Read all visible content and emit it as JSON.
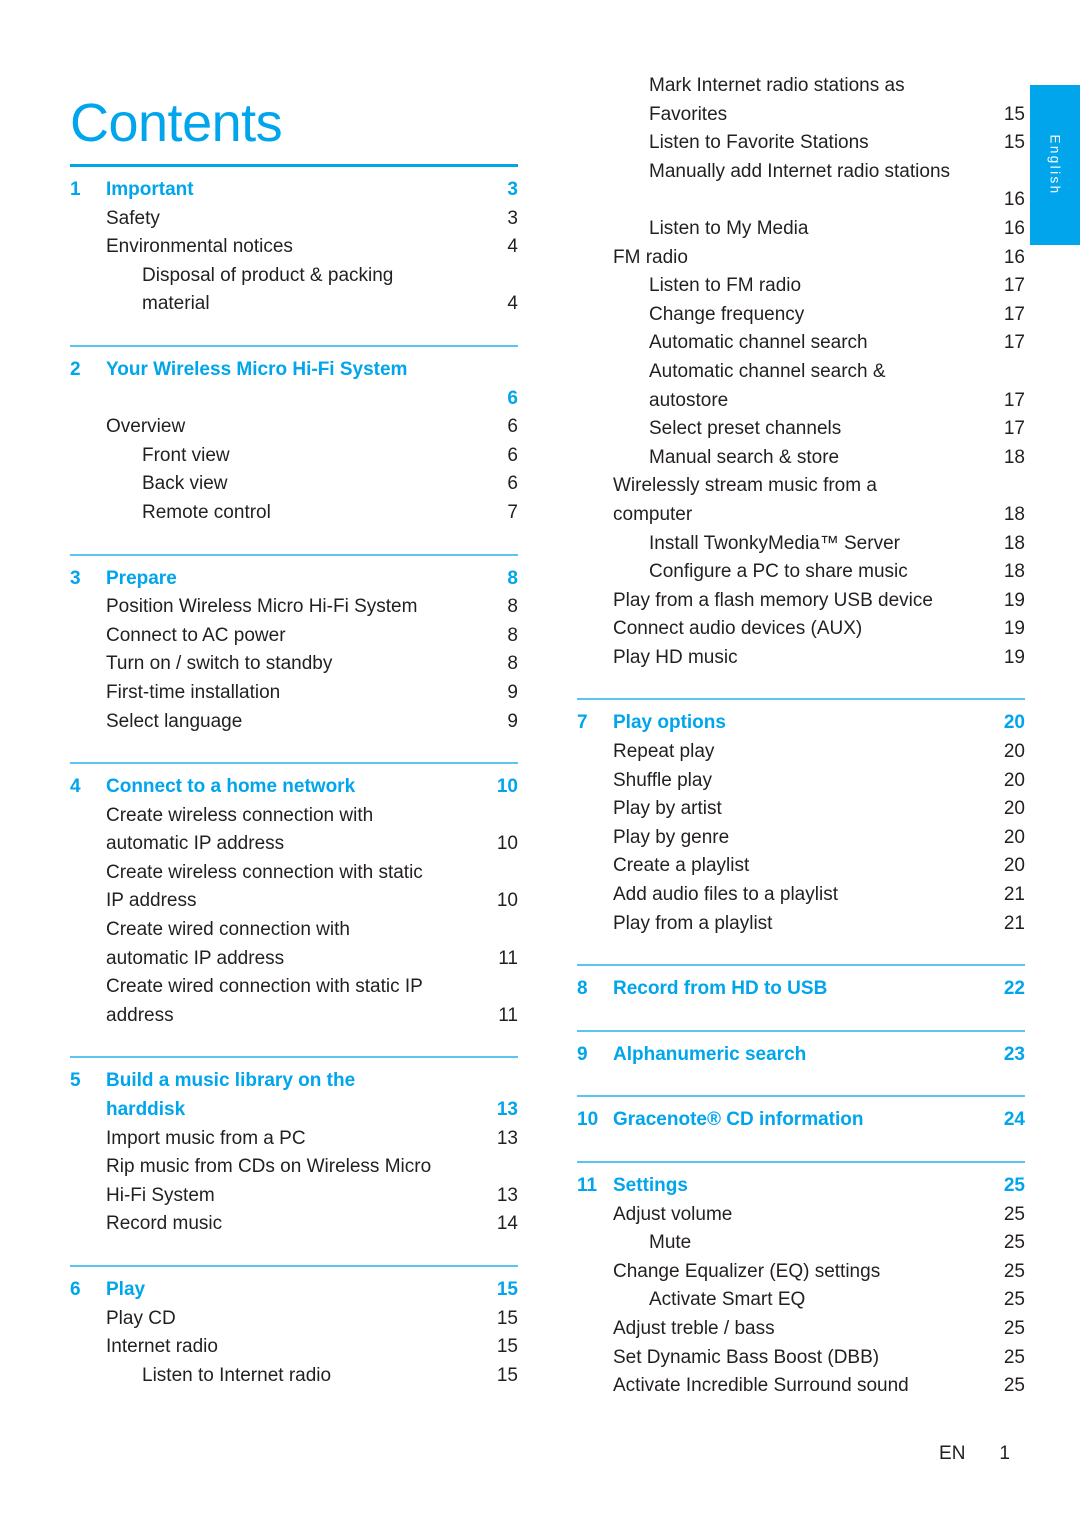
{
  "page_title": "Contents",
  "language_tab": "English",
  "colors": {
    "accent": "#00a5ec",
    "rule_light": "#5bc5f2",
    "text": "#231f20"
  },
  "footer": {
    "language_code": "EN",
    "page_number": "1"
  },
  "left_column": [
    {
      "type": "chapter",
      "number": "1",
      "title": "Important",
      "page": "3",
      "rule": "thick",
      "entries": [
        {
          "level": 1,
          "title": "Safety",
          "page": "3"
        },
        {
          "level": 1,
          "title": "Environmental notices",
          "page": "4"
        },
        {
          "level": 2,
          "title": "Disposal of product & packing",
          "page": ""
        },
        {
          "level": 2,
          "wrap": true,
          "title": "material",
          "page": "4"
        }
      ]
    },
    {
      "type": "chapter",
      "number": "2",
      "title": "Your Wireless Micro Hi-Fi System",
      "page": "6",
      "page_on_own_line": true,
      "rule": "thin",
      "entries": [
        {
          "level": 1,
          "title": "Overview",
          "page": "6"
        },
        {
          "level": 2,
          "title": "Front view",
          "page": "6"
        },
        {
          "level": 2,
          "title": "Back view",
          "page": "6"
        },
        {
          "level": 2,
          "title": "Remote control",
          "page": "7"
        }
      ]
    },
    {
      "type": "chapter",
      "number": "3",
      "title": "Prepare",
      "page": "8",
      "rule": "thin",
      "entries": [
        {
          "level": 1,
          "title": "Position Wireless Micro Hi-Fi System",
          "page": "8"
        },
        {
          "level": 1,
          "title": "Connect to AC power",
          "page": "8"
        },
        {
          "level": 1,
          "title": "Turn on / switch to standby",
          "page": "8"
        },
        {
          "level": 1,
          "title": "First-time installation",
          "page": "9"
        },
        {
          "level": 1,
          "title": "Select language",
          "page": "9"
        }
      ]
    },
    {
      "type": "chapter",
      "number": "4",
      "title": "Connect to a home network",
      "page": "10",
      "rule": "thin",
      "entries": [
        {
          "level": 1,
          "title": "Create wireless connection with",
          "page": ""
        },
        {
          "level": 1,
          "wrap": true,
          "title": "automatic IP address",
          "page": "10"
        },
        {
          "level": 1,
          "title": "Create wireless connection with static",
          "page": ""
        },
        {
          "level": 1,
          "wrap": true,
          "title": "IP address",
          "page": "10"
        },
        {
          "level": 1,
          "title": "Create wired connection with",
          "page": ""
        },
        {
          "level": 1,
          "wrap": true,
          "title": "automatic IP address",
          "page": "11"
        },
        {
          "level": 1,
          "title": "Create wired connection with static IP",
          "page": ""
        },
        {
          "level": 1,
          "wrap": true,
          "title": "address",
          "page": "11"
        }
      ]
    },
    {
      "type": "chapter",
      "number": "5",
      "title": "Build a music library on the",
      "title_line2": "harddisk",
      "page": "13",
      "rule": "thin",
      "entries": [
        {
          "level": 1,
          "title": "Import music from a PC",
          "page": "13"
        },
        {
          "level": 1,
          "title": "Rip music from CDs on Wireless Micro",
          "page": ""
        },
        {
          "level": 1,
          "wrap": true,
          "title": "Hi-Fi System",
          "page": "13"
        },
        {
          "level": 1,
          "title": "Record music",
          "page": "14"
        }
      ]
    },
    {
      "type": "chapter",
      "number": "6",
      "title": "Play",
      "page": "15",
      "rule": "thin",
      "entries": [
        {
          "level": 1,
          "title": "Play CD",
          "page": "15"
        },
        {
          "level": 1,
          "title": "Internet radio",
          "page": "15"
        },
        {
          "level": 2,
          "title": "Listen to Internet radio",
          "page": "15"
        }
      ]
    }
  ],
  "right_column_continued": [
    {
      "level": 2,
      "title": "Mark Internet radio stations as",
      "page": ""
    },
    {
      "level": 2,
      "wrap": true,
      "title": "Favorites",
      "page": "15"
    },
    {
      "level": 2,
      "title": "Listen to Favorite Stations",
      "page": "15"
    },
    {
      "level": 2,
      "title": "Manually add Internet radio stations",
      "page": ""
    },
    {
      "level": 2,
      "wrap": true,
      "title": "",
      "page": "16"
    },
    {
      "level": 2,
      "title": "Listen to My Media",
      "page": "16"
    },
    {
      "level": 1,
      "title": "FM radio",
      "page": "16"
    },
    {
      "level": 2,
      "title": "Listen to FM radio",
      "page": "17"
    },
    {
      "level": 2,
      "title": "Change frequency",
      "page": "17"
    },
    {
      "level": 2,
      "title": "Automatic channel search",
      "page": "17"
    },
    {
      "level": 2,
      "title": "Automatic channel search &",
      "page": ""
    },
    {
      "level": 2,
      "wrap": true,
      "title": "autostore",
      "page": "17"
    },
    {
      "level": 2,
      "title": "Select preset channels",
      "page": "17"
    },
    {
      "level": 2,
      "title": "Manual search & store",
      "page": "18"
    },
    {
      "level": 1,
      "title": "Wirelessly stream music from a",
      "page": ""
    },
    {
      "level": 1,
      "wrap": true,
      "title": "computer",
      "page": "18"
    },
    {
      "level": 2,
      "title": "Install TwonkyMedia™ Server",
      "page": "18"
    },
    {
      "level": 2,
      "title": "Configure a PC to share music",
      "page": "18"
    },
    {
      "level": 1,
      "title": "Play from a flash memory USB device",
      "page": "19"
    },
    {
      "level": 1,
      "title": "Connect audio devices (AUX)",
      "page": "19"
    },
    {
      "level": 1,
      "title": "Play HD music",
      "page": "19"
    }
  ],
  "right_column": [
    {
      "type": "chapter",
      "number": "7",
      "title": "Play options",
      "page": "20",
      "rule": "thin",
      "entries": [
        {
          "level": 1,
          "title": "Repeat play",
          "page": "20"
        },
        {
          "level": 1,
          "title": "Shuffle play",
          "page": "20"
        },
        {
          "level": 1,
          "title": "Play by artist",
          "page": "20"
        },
        {
          "level": 1,
          "title": "Play by genre",
          "page": "20"
        },
        {
          "level": 1,
          "title": "Create a playlist",
          "page": "20"
        },
        {
          "level": 1,
          "title": "Add audio files to a playlist",
          "page": "21"
        },
        {
          "level": 1,
          "title": "Play from a playlist",
          "page": "21"
        }
      ]
    },
    {
      "type": "chapter",
      "number": "8",
      "title": "Record from HD to USB",
      "page": "22",
      "rule": "thin",
      "entries": []
    },
    {
      "type": "chapter",
      "number": "9",
      "title": "Alphanumeric search",
      "page": "23",
      "rule": "thin",
      "entries": []
    },
    {
      "type": "chapter",
      "number": "10",
      "title": "Gracenote® CD information",
      "page": "24",
      "rule": "thin",
      "entries": []
    },
    {
      "type": "chapter",
      "number": "11",
      "title": "Settings",
      "page": "25",
      "rule": "thin",
      "entries": [
        {
          "level": 1,
          "title": "Adjust volume",
          "page": "25"
        },
        {
          "level": 2,
          "title": "Mute",
          "page": "25"
        },
        {
          "level": 1,
          "title": "Change Equalizer (EQ) settings",
          "page": "25"
        },
        {
          "level": 2,
          "title": "Activate Smart EQ",
          "page": "25"
        },
        {
          "level": 1,
          "title": "Adjust treble / bass",
          "page": "25"
        },
        {
          "level": 1,
          "title": "Set Dynamic Bass Boost (DBB)",
          "page": "25"
        },
        {
          "level": 1,
          "title": "Activate Incredible Surround sound",
          "page": "25"
        }
      ]
    }
  ]
}
